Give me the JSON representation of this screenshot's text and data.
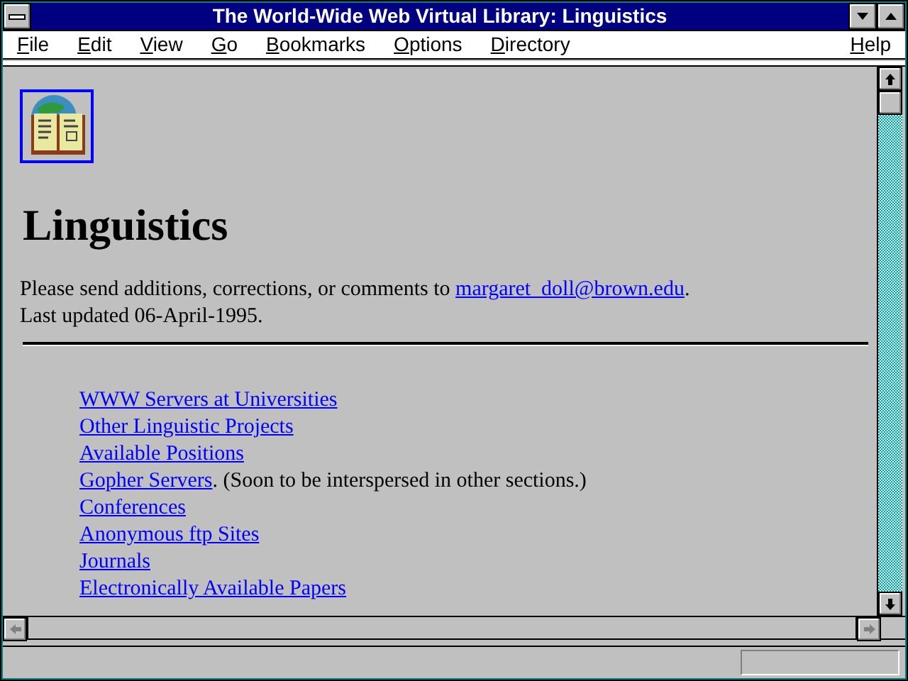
{
  "window": {
    "title": "The World-Wide Web Virtual Library: Linguistics"
  },
  "menu": [
    {
      "label": "File"
    },
    {
      "label": "Edit"
    },
    {
      "label": "View"
    },
    {
      "label": "Go"
    },
    {
      "label": "Bookmarks"
    },
    {
      "label": "Options"
    },
    {
      "label": "Directory"
    },
    {
      "label": "Help"
    }
  ],
  "page": {
    "heading": "Linguistics",
    "contact_text": "Please send additions, corrections, or comments to",
    "contact_link": "margaret_doll@brown.edu",
    "contact_end": ".",
    "updated": "Last updated 06-April-1995.",
    "links": [
      {
        "label": "WWW Servers at Universities"
      },
      {
        "label": "Other Linguistic Projects"
      },
      {
        "label": "Available Positions"
      },
      {
        "label": "Gopher Servers",
        "note": ". (Soon to be interspersed in other sections.)"
      },
      {
        "label": "Conferences"
      },
      {
        "label": "Anonymous ftp Sites"
      },
      {
        "label": "Journals"
      },
      {
        "label": "Electronically Available Papers"
      }
    ]
  }
}
